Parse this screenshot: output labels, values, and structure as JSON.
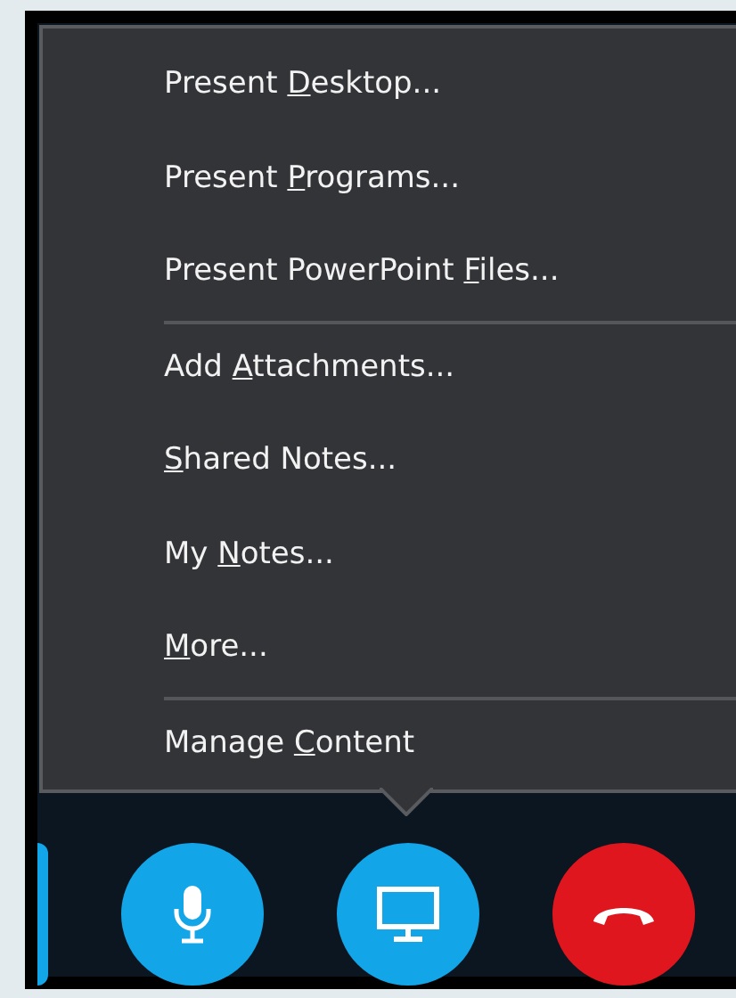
{
  "menu": {
    "groups": [
      [
        {
          "before": "Present ",
          "key": "D",
          "after": "esktop..."
        },
        {
          "before": "Present ",
          "key": "P",
          "after": "rograms..."
        },
        {
          "before": "Present PowerPoint ",
          "key": "F",
          "after": "iles..."
        }
      ],
      [
        {
          "before": "Add ",
          "key": "A",
          "after": "ttachments..."
        },
        {
          "key": "S",
          "after": "hared Notes..."
        },
        {
          "before": "My ",
          "key": "N",
          "after": "otes..."
        },
        {
          "key": "M",
          "after": "ore..."
        }
      ],
      [
        {
          "before": "Manage ",
          "key": "C",
          "after": "ontent"
        }
      ]
    ]
  },
  "call_controls": [
    {
      "kind": "partial",
      "color": "#12a5e8"
    },
    {
      "kind": "microphone",
      "color": "#12a5e8"
    },
    {
      "kind": "present",
      "color": "#12a5e8"
    },
    {
      "kind": "hang-up",
      "color": "#e0161f"
    }
  ]
}
